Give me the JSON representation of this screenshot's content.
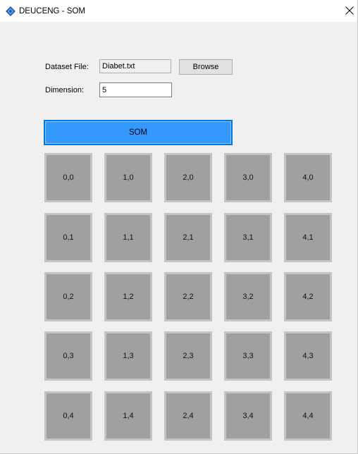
{
  "window": {
    "title": "DEUCENG - SOM",
    "close_glyph": "✕"
  },
  "form": {
    "dataset_label": "Dataset File:",
    "dataset_value": "Diabet.txt",
    "browse_label": "Browse",
    "dimension_label": "Dimension:",
    "dimension_value": "5"
  },
  "actions": {
    "som_label": "SOM"
  },
  "grid": {
    "rows": [
      [
        "0,0",
        "1,0",
        "2,0",
        "3,0",
        "4,0"
      ],
      [
        "0,1",
        "1,1",
        "2,1",
        "3,1",
        "4,1"
      ],
      [
        "0,2",
        "1,2",
        "2,2",
        "3,2",
        "4,2"
      ],
      [
        "0,3",
        "1,3",
        "2,3",
        "3,3",
        "4,3"
      ],
      [
        "0,4",
        "1,4",
        "2,4",
        "3,4",
        "4,4"
      ]
    ]
  },
  "colors": {
    "accent": "#3399ff",
    "accent_border": "#0078d7",
    "cell_fill": "#a0a0a0",
    "cell_border": "#c4c4c4",
    "window_bg": "#f0f0f0",
    "icon_brand": "#1f5fa8"
  },
  "icons": {
    "app": "app-diamond-icon",
    "close": "close-icon"
  }
}
